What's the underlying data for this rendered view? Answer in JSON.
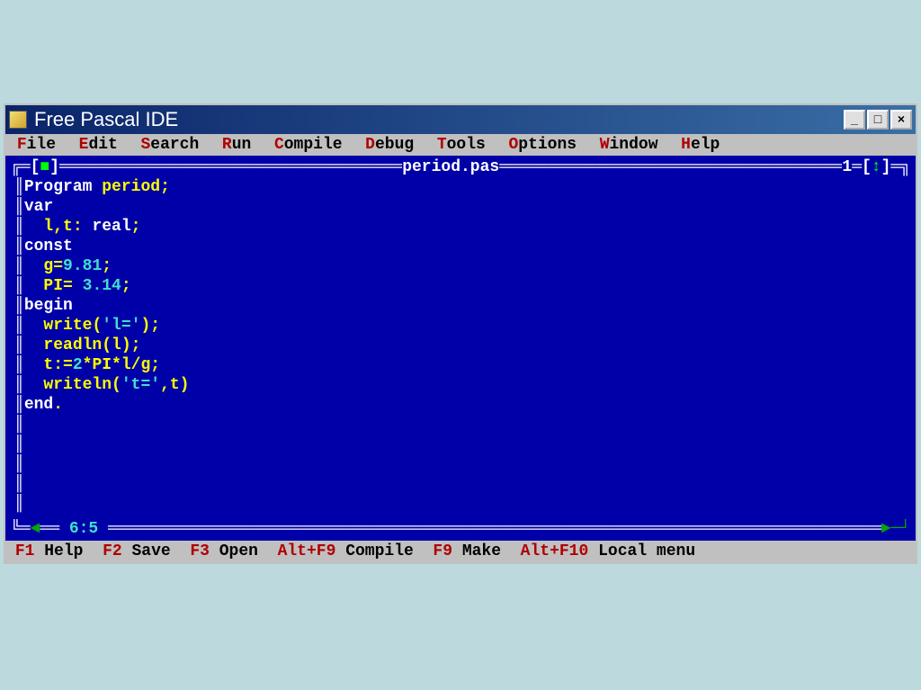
{
  "window": {
    "title": "Free Pascal IDE"
  },
  "menu": {
    "file": "File",
    "edit": "Edit",
    "search": "Search",
    "run": "Run",
    "compile": "Compile",
    "debug": "Debug",
    "tools": "Tools",
    "options": "Options",
    "window": "Window",
    "help": "Help"
  },
  "editor": {
    "filename": "period.pas",
    "window_number": "1",
    "cursor_pos": "6:5",
    "code": {
      "l1_kw": "Program",
      "l1_id": "period",
      "l1_sc": ";",
      "l2_kw": "var",
      "l3_id": "l,t",
      "l3_colon": ":",
      "l3_type": "real",
      "l3_sc": ";",
      "l4_kw": "const",
      "l5_id": "g",
      "l5_eq": "=",
      "l5_num": "9.81",
      "l5_sc": ";",
      "l6_id": "PI",
      "l6_eq": "=",
      "l6_num": "3.14",
      "l6_sc": ";",
      "l7_kw": "begin",
      "l8_fn": "write",
      "l8_op": "(",
      "l8_str": "'l='",
      "l8_op2": ");",
      "l9_fn": "readln",
      "l9_op": "(l);",
      "l10_id": "t",
      "l10_assign": ":=",
      "l10_num": "2",
      "l10_rest": "*PI*l/g;",
      "l11_fn": "writeln",
      "l11_op": "(",
      "l11_str": "'t='",
      "l11_cm": ",t)",
      "l12_kw": "end",
      "l12_dot": "."
    }
  },
  "status": {
    "f1_key": "F1",
    "f1_lbl": "Help",
    "f2_key": "F2",
    "f2_lbl": "Save",
    "f3_key": "F3",
    "f3_lbl": "Open",
    "compile_key": "Alt+F9",
    "compile_lbl": "Compile",
    "make_key": "F9",
    "make_lbl": "Make",
    "local_key": "Alt+F10",
    "local_lbl": "Local menu"
  }
}
